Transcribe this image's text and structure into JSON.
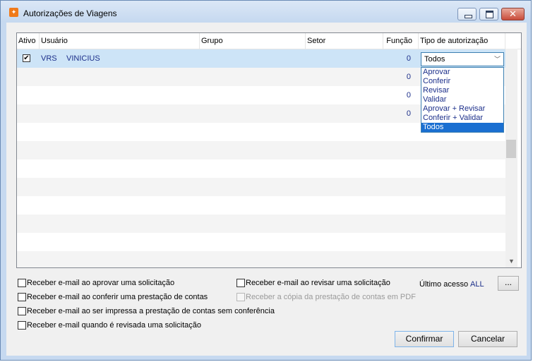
{
  "window": {
    "title": "Autorizações de Viagens",
    "icon": "app-icon"
  },
  "grid": {
    "columns": [
      "Ativo",
      "Usuário",
      "Grupo",
      "Setor",
      "Função",
      "Tipo de autorização"
    ],
    "rows": [
      {
        "ativo": "✔",
        "usuario_code": "VRS",
        "usuario_name": "VINICIUS",
        "funcao": "0",
        "tipo": "Todos"
      },
      {
        "funcao": "0"
      },
      {
        "funcao": "0"
      },
      {
        "funcao": "0"
      }
    ],
    "dropdown_options": [
      "Aprovar",
      "Conferir",
      "Revisar",
      "Validar",
      "Aprovar  + Revisar",
      "Conferir  + Validar",
      "Todos"
    ],
    "selected_option": "Todos"
  },
  "options": {
    "email_aprovar": "Receber e-mail ao aprovar uma solicitação",
    "email_revisar": "Receber e-mail ao revisar uma solicitação",
    "email_conferir": "Receber e-mail ao conferir uma prestação de contas",
    "copia_pdf": "Receber a cópia da prestação de contas em PDF",
    "email_impressa": "Receber e-mail ao ser impressa a prestação de contas sem conferência",
    "email_revisada": "Receber e-mail quando é revisada uma solicitação",
    "ultimo_acesso_label": "Último acesso",
    "ultimo_acesso_value": "ALL",
    "ellipsis": "..."
  },
  "buttons": {
    "confirmar": "Confirmar",
    "cancelar": "Cancelar"
  }
}
